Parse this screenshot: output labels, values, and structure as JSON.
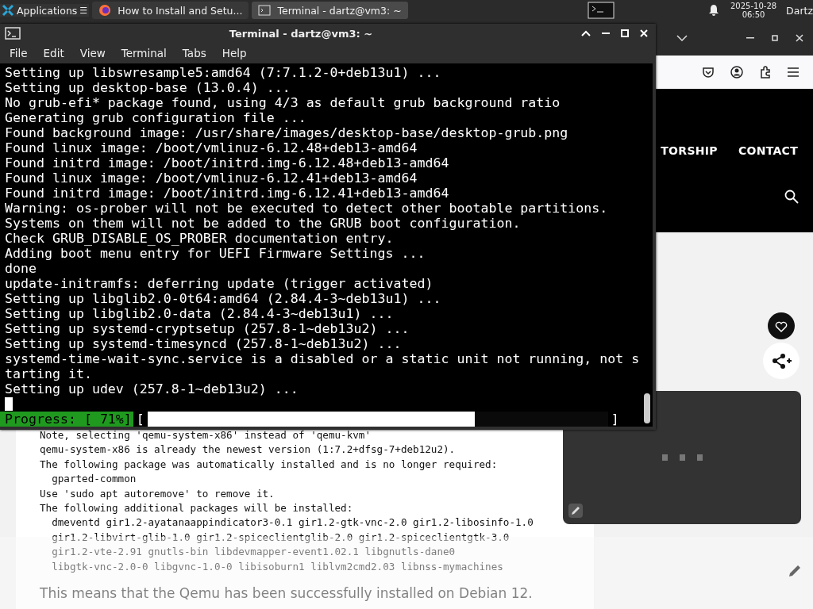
{
  "taskbar": {
    "apps_label": "Applications",
    "menu_glyph": "☰",
    "tasks": [
      {
        "label": "How to Install and Setu...",
        "kind": "browser",
        "selected": false
      },
      {
        "label": "Terminal - dartz@vm3: ~",
        "kind": "terminal",
        "selected": true
      }
    ],
    "date": "2025-10-28",
    "time": "06:50",
    "user": "Dartz"
  },
  "terminal": {
    "title": "Terminal - dartz@vm3: ~",
    "menu": [
      "File",
      "Edit",
      "View",
      "Terminal",
      "Tabs",
      "Help"
    ],
    "lines": [
      "Setting up libswresample5:amd64 (7:7.1.2-0+deb13u1) ...",
      "Setting up desktop-base (13.0.4) ...",
      "No grub-efi* package found, using 4/3 as default grub background ratio",
      "Generating grub configuration file ...",
      "Found background image: /usr/share/images/desktop-base/desktop-grub.png",
      "Found linux image: /boot/vmlinuz-6.12.48+deb13-amd64",
      "Found initrd image: /boot/initrd.img-6.12.48+deb13-amd64",
      "Found linux image: /boot/vmlinuz-6.12.41+deb13-amd64",
      "Found initrd image: /boot/initrd.img-6.12.41+deb13-amd64",
      "Warning: os-prober will not be executed to detect other bootable partitions.",
      "Systems on them will not be added to the GRUB boot configuration.",
      "Check GRUB_DISABLE_OS_PROBER documentation entry.",
      "Adding boot menu entry for UEFI Firmware Settings ...",
      "done",
      "update-initramfs: deferring update (trigger activated)",
      "Setting up libglib2.0-0t64:amd64 (2.84.4-3~deb13u1) ...",
      "Setting up libglib2.0-data (2.84.4-3~deb13u1) ...",
      "Setting up systemd-cryptsetup (257.8-1~deb13u2) ...",
      "Setting up systemd-timesyncd (257.8-1~deb13u2) ...",
      "systemd-time-wait-sync.service is a disabled or a static unit not running, not s",
      "tarting it.",
      "Setting up udev (257.8-1~deb13u2) ..."
    ],
    "progress": {
      "label": "Progress: [ 71%]",
      "open": "[",
      "close": "]",
      "level": 0.71
    }
  },
  "browser": {
    "nav": [
      "TORSHIP",
      "CONTACT"
    ],
    "code_lines": [
      "Note, selecting 'qemu-system-x86' instead of 'qemu-kvm'",
      "qemu-system-x86 is already the newest version (1:7.2+dfsg-7+deb12u2).",
      "The following package was automatically installed and is no longer required:",
      "  gparted-common",
      "Use 'sudo apt autoremove' to remove it.",
      "The following additional packages will be installed:",
      "  dmeventd gir1.2-ayatanaappindicator3-0.1 gir1.2-gtk-vnc-2.0 gir1.2-libosinfo-1.0",
      "  gir1.2-libvirt-glib-1.0 gir1.2-spiceclientglib-2.0 gir1.2-spiceclientgtk-3.0",
      "  gir1.2-vte-2.91 gnutls-bin libdevmapper-event1.02.1 libgnutls-dane0",
      "  libgtk-vnc-2.0-0 libgvnc-1.0-0 libisoburn1 liblvm2cmd2.03 libnss-mymachines"
    ],
    "paragraph": "This means that the Qemu has been successfully installed on Debian 12."
  }
}
